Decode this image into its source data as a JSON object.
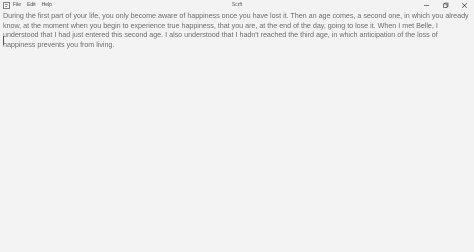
{
  "window": {
    "title": "Scrft"
  },
  "menu": {
    "items": [
      {
        "label": "File"
      },
      {
        "label": "Edit"
      },
      {
        "label": "Help"
      }
    ]
  },
  "controls": {
    "minimize_icon": "minimize-icon",
    "maximize_icon": "maximize-icon",
    "close_icon": "close-icon"
  },
  "editor": {
    "text": "During the first part of your life, you only become aware of happiness once you have lost it. Then an age comes, a second one, in which you already know, at the moment when you begin to experience true happiness, that you are, at the end of the day, going to lose it. When I met Belle, I understood that I had just entered this second age. I also understood that I hadn't reached the third age, in which anticipation of the loss of happiness prevents you from living."
  },
  "colors": {
    "background": "#f3f3f3",
    "text": "#6e6e6e"
  }
}
